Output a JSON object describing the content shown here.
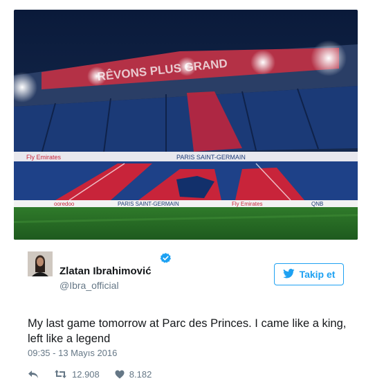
{
  "photo": {
    "banner_text": "RÊVONS PLUS GRAND",
    "sponsor": "Fly Emirates",
    "club_name": "PARIS SAINT-GERMAIN",
    "sponsor_b": "ooredoo",
    "sponsor_c": "QNB"
  },
  "author": {
    "name": "Zlatan Ibrahimović",
    "handle": "@Ibra_official",
    "verified": true
  },
  "follow_label": "Takip et",
  "tweet": {
    "text_line1": "My last game tomorrow at Parc des Princes. I came like a king,",
    "text_line2": "left like a legend",
    "timestamp": "09:35 - 13 Mayıs 2016",
    "retweets": "12.908",
    "likes": "8.182"
  },
  "colors": {
    "accent": "#1da1f2",
    "secondary_text": "#657786",
    "psg_blue": "#1b3a77",
    "psg_red": "#c8243a"
  }
}
